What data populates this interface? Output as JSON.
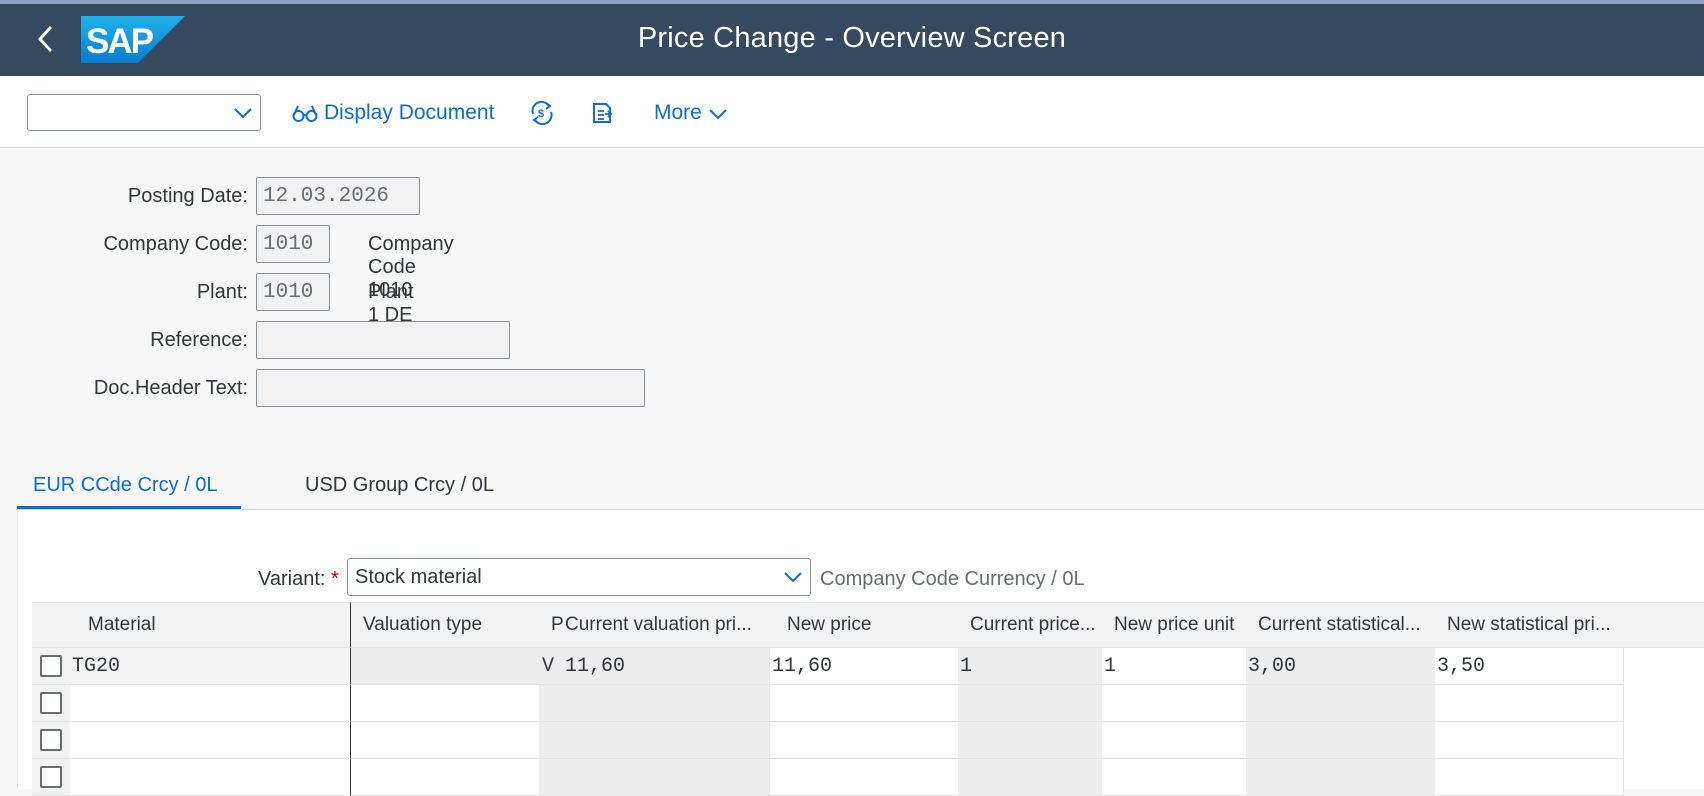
{
  "shell": {
    "title": "Price Change - Overview Screen",
    "logo_text": "SAP"
  },
  "toolbar": {
    "select_value": "",
    "display_document": "Display Document",
    "more": "More"
  },
  "form": {
    "posting_date": {
      "label": "Posting Date:",
      "value": "12.03.2026"
    },
    "company_code": {
      "label": "Company Code:",
      "value": "1010",
      "desc": "Company Code 1010"
    },
    "plant": {
      "label": "Plant:",
      "value": "1010",
      "desc": "Plant 1 DE"
    },
    "reference": {
      "label": "Reference:",
      "value": ""
    },
    "doc_header_text": {
      "label": "Doc.Header Text:",
      "value": ""
    }
  },
  "tabs": [
    {
      "label": "EUR  CCde Crcy / 0L",
      "active": true
    },
    {
      "label": "USD  Group Crcy / 0L",
      "active": false
    }
  ],
  "variant": {
    "label": "Variant:",
    "required_mark": "*",
    "value": "Stock material",
    "desc": "Company Code Currency / 0L"
  },
  "table": {
    "columns": [
      "Material",
      "Valuation type",
      "P",
      "Current valuation pri...",
      "New price",
      "Current price...",
      "New price unit",
      "Current statistical...",
      "New statistical pri..."
    ],
    "rows": [
      [
        "TG20",
        "",
        "V",
        "11,60",
        "11,60",
        "1",
        "1",
        "3,00",
        "3,50"
      ],
      [
        "",
        "",
        "",
        "",
        "",
        "",
        "",
        "",
        ""
      ],
      [
        "",
        "",
        "",
        "",
        "",
        "",
        "",
        "",
        ""
      ],
      [
        "",
        "",
        "",
        "",
        "",
        "",
        "",
        "",
        ""
      ]
    ]
  },
  "colors": {
    "shell": "#354a5f",
    "accent": "#0a6ed1",
    "required": "#bb0000"
  }
}
